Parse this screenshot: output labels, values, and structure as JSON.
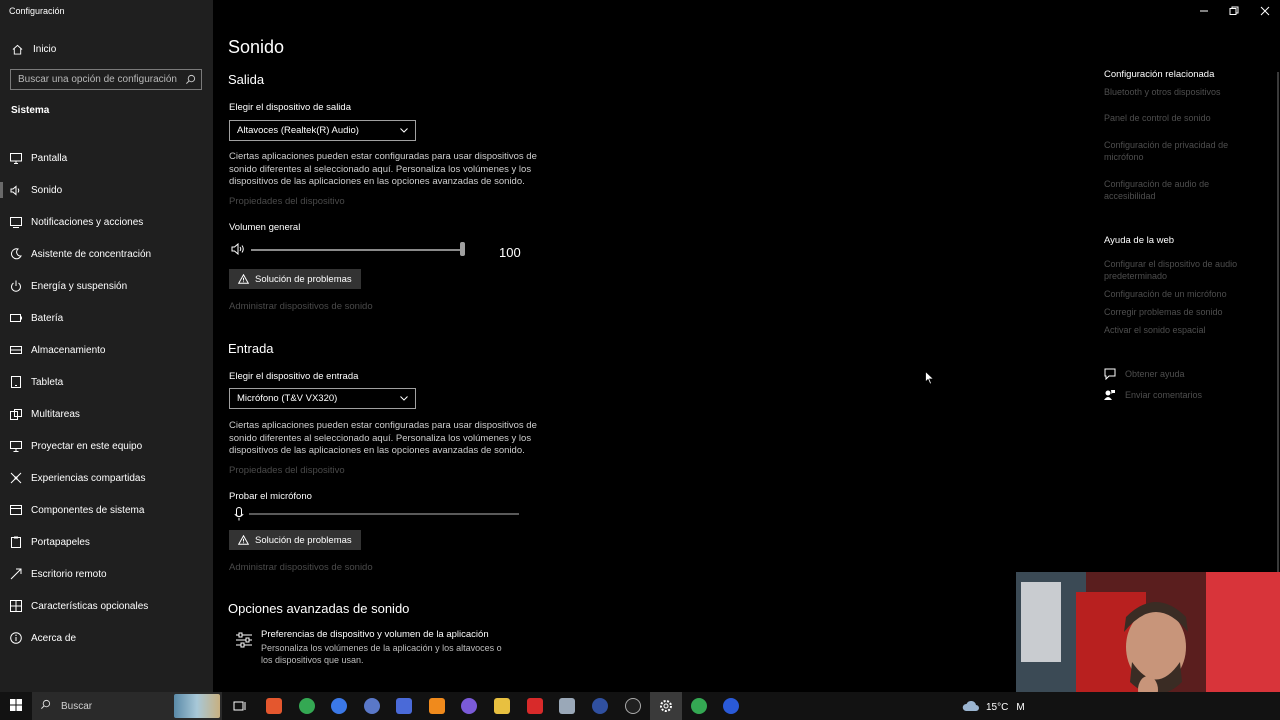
{
  "window": {
    "title": "Configuración"
  },
  "sidebar": {
    "home_label": "Inicio",
    "search_placeholder": "Buscar una opción de configuración",
    "section_title": "Sistema",
    "items": [
      {
        "label": "Pantalla",
        "icon": "monitor-icon"
      },
      {
        "label": "Sonido",
        "icon": "speaker-icon",
        "active": true
      },
      {
        "label": "Notificaciones y acciones",
        "icon": "notification-icon"
      },
      {
        "label": "Asistente de concentración",
        "icon": "moon-icon"
      },
      {
        "label": "Energía y suspensión",
        "icon": "power-icon"
      },
      {
        "label": "Batería",
        "icon": "battery-icon"
      },
      {
        "label": "Almacenamiento",
        "icon": "storage-icon"
      },
      {
        "label": "Tableta",
        "icon": "tablet-icon"
      },
      {
        "label": "Multitareas",
        "icon": "multitask-icon"
      },
      {
        "label": "Proyectar en este equipo",
        "icon": "project-icon"
      },
      {
        "label": "Experiencias compartidas",
        "icon": "shared-icon"
      },
      {
        "label": "Componentes de sistema",
        "icon": "components-icon"
      },
      {
        "label": "Portapapeles",
        "icon": "clipboard-icon"
      },
      {
        "label": "Escritorio remoto",
        "icon": "remote-icon"
      },
      {
        "label": "Características opcionales",
        "icon": "features-icon"
      },
      {
        "label": "Acerca de",
        "icon": "info-icon"
      }
    ]
  },
  "main": {
    "title": "Sonido",
    "output": {
      "heading": "Salida",
      "device_label": "Elegir el dispositivo de salida",
      "device_value": "Altavoces (Realtek(R) Audio)",
      "description": "Ciertas aplicaciones pueden estar configuradas para usar dispositivos de sonido diferentes al seleccionado aquí. Personaliza los volúmenes y los dispositivos de las aplicaciones en las opciones avanzadas de sonido.",
      "properties_link": "Propiedades del dispositivo",
      "volume_label": "Volumen general",
      "volume_value": "100",
      "volume_level": 1.0,
      "troubleshoot_label": "Solución de problemas",
      "manage_link": "Administrar dispositivos de sonido"
    },
    "input": {
      "heading": "Entrada",
      "device_label": "Elegir el dispositivo de entrada",
      "device_value": "Micrófono (T&V VX320)",
      "description": "Ciertas aplicaciones pueden estar configuradas para usar dispositivos de sonido diferentes al seleccionado aquí. Personaliza los volúmenes y los dispositivos de las aplicaciones en las opciones avanzadas de sonido.",
      "properties_link": "Propiedades del dispositivo",
      "test_label": "Probar el micrófono",
      "mic_level": 0,
      "troubleshoot_label": "Solución de problemas",
      "manage_link": "Administrar dispositivos de sonido"
    },
    "advanced": {
      "heading": "Opciones avanzadas de sonido",
      "item_title": "Preferencias de dispositivo y volumen de la aplicación",
      "item_desc": "Personaliza los volúmenes de la aplicación y los altavoces o los dispositivos que usan."
    }
  },
  "related": {
    "heading": "Configuración relacionada",
    "links": [
      "Bluetooth y otros dispositivos",
      "Panel de control de sonido",
      "Configuración de privacidad de micrófono",
      "Configuración de audio de accesibilidad"
    ]
  },
  "web_help": {
    "heading": "Ayuda de la web",
    "links": [
      "Configurar el dispositivo de audio predeterminado",
      "Configuración de un micrófono",
      "Corregir problemas de sonido",
      "Activar el sonido espacial"
    ]
  },
  "support": {
    "get_help": "Obtener ayuda",
    "feedback": "Enviar comentarios"
  },
  "taskbar": {
    "search_label": "Buscar",
    "temperature": "15°C",
    "weather_extra": "M"
  }
}
